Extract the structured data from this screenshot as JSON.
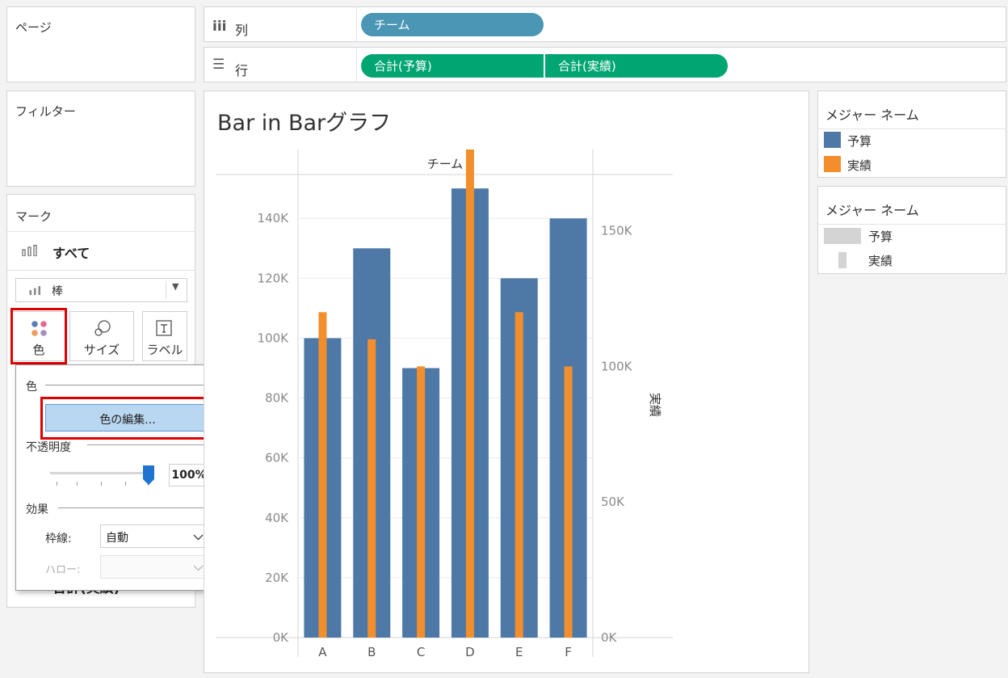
{
  "shelves": {
    "pages_label": "ページ",
    "columns": {
      "icon": "iii",
      "label": "列",
      "pill": "チーム"
    },
    "rows": {
      "icon": "☰",
      "label": "行",
      "pills": [
        "合計(予算)",
        "合計(実績)"
      ]
    },
    "filters_label": "フィルター"
  },
  "marks": {
    "title": "マーク",
    "all_label": "すべて",
    "mark_type": "棒",
    "buttons": {
      "color": "色",
      "size": "サイズ",
      "label": "ラベル"
    },
    "bottom_partial": "合計(実績)"
  },
  "color_popup": {
    "color_section": "色",
    "edit_colors_button": "色の編集...",
    "opacity_section": "不透明度",
    "opacity_value": "100%",
    "opacity_fraction": 1.0,
    "effects_section": "効果",
    "border_label": "枠線:",
    "border_value": "自動",
    "halo_label": "ハロー:",
    "halo_value": ""
  },
  "colors": {
    "budget": "#4e79a7",
    "actual": "#f28e2b",
    "highlight_red": "#e10000",
    "pill_blue": "#4a96b4",
    "pill_green": "#00a572"
  },
  "legends": {
    "color_legend": {
      "title": "メジャー ネーム",
      "items": [
        "予算",
        "実績"
      ]
    },
    "size_legend": {
      "title": "メジャー ネーム",
      "items": [
        "予算",
        "実績"
      ]
    }
  },
  "chart_data": {
    "type": "bar",
    "title": "Bar in Barグラフ",
    "column_header": "チーム",
    "categories": [
      "A",
      "B",
      "C",
      "D",
      "E",
      "F"
    ],
    "series": [
      {
        "name": "予算",
        "values": [
          100000,
          130000,
          90000,
          150000,
          120000,
          140000
        ],
        "axis": "left"
      },
      {
        "name": "実績",
        "values": [
          120000,
          110000,
          100000,
          180000,
          120000,
          100000
        ],
        "axis": "right"
      }
    ],
    "left_axis": {
      "ylim": [
        0,
        163000
      ],
      "ticks": [
        "0K",
        "20K",
        "40K",
        "60K",
        "80K",
        "100K",
        "120K",
        "140K"
      ]
    },
    "right_axis": {
      "label": "実績",
      "ylim": [
        0,
        180000
      ],
      "ticks": [
        "0K",
        "50K",
        "100K",
        "150K"
      ]
    },
    "grid": true
  }
}
